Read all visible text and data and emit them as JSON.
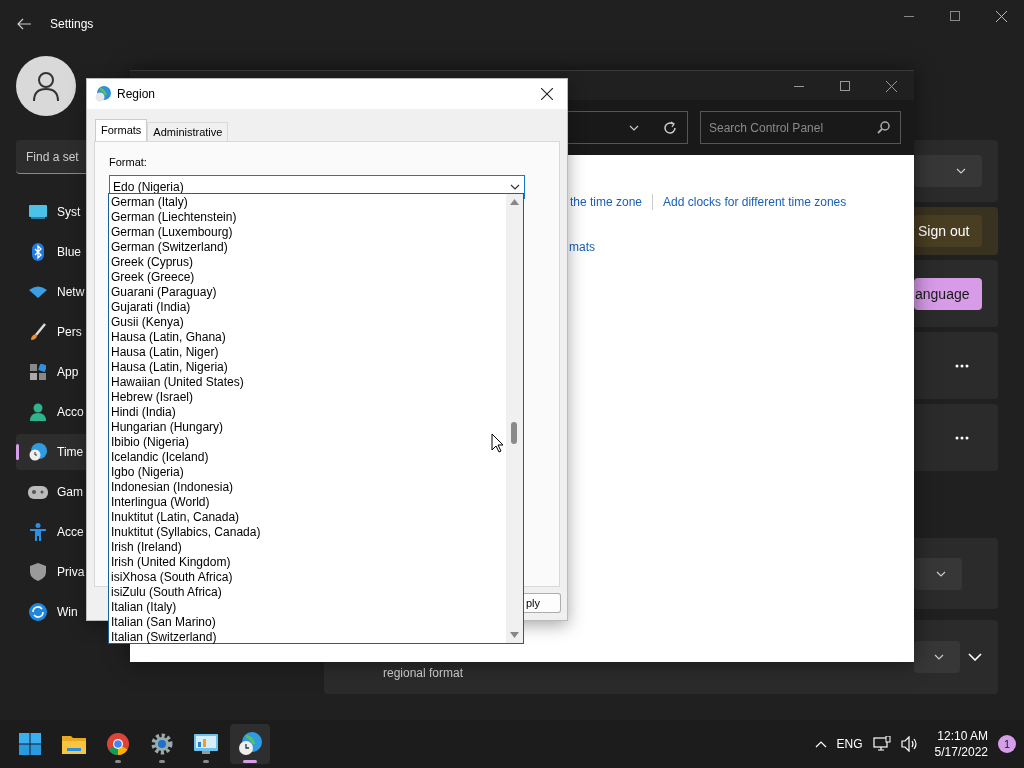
{
  "settings": {
    "title": "Settings",
    "search": {
      "placeholder": "Find a set"
    },
    "sidebar": {
      "items": [
        {
          "label": "Syst",
          "kind": "system",
          "selected": false
        },
        {
          "label": "Blue",
          "kind": "bluetooth",
          "selected": false
        },
        {
          "label": "Netw",
          "kind": "network",
          "selected": false
        },
        {
          "label": "Pers",
          "kind": "brush",
          "selected": false
        },
        {
          "label": "App",
          "kind": "apps",
          "selected": false
        },
        {
          "label": "Acco",
          "kind": "accounts",
          "selected": false
        },
        {
          "label": "Time",
          "kind": "time",
          "selected": true
        },
        {
          "label": "Gam",
          "kind": "gaming",
          "selected": false
        },
        {
          "label": "Acce",
          "kind": "accessibility",
          "selected": false
        },
        {
          "label": "Priva",
          "kind": "privacy",
          "selected": false
        },
        {
          "label": "Win",
          "kind": "update",
          "selected": false
        }
      ]
    },
    "cards": [
      {
        "kind": "dropdown"
      },
      {
        "kind": "warning_button",
        "label": "Sign out"
      },
      {
        "kind": "accent_button",
        "label": "anguage"
      },
      {
        "kind": "more"
      },
      {
        "kind": "more"
      },
      {
        "kind": "dropdown"
      },
      {
        "kind": "dropdown_expand",
        "description": "regional format"
      }
    ]
  },
  "control_panel": {
    "search": {
      "placeholder": "Search Control Panel"
    },
    "links": [
      {
        "label": "the time zone"
      },
      {
        "label": "Add clocks for different time zones"
      }
    ],
    "second_link": "mats"
  },
  "region_dialog": {
    "title": "Region",
    "tabs": [
      {
        "label": "Formats",
        "selected": true
      },
      {
        "label": "Administrative",
        "selected": false
      }
    ],
    "format_label": "Format:",
    "format_value": "Edo (Nigeria)",
    "apply_button": "ply",
    "format_list": [
      "German (Italy)",
      "German (Liechtenstein)",
      "German (Luxembourg)",
      "German (Switzerland)",
      "Greek (Cyprus)",
      "Greek (Greece)",
      "Guarani (Paraguay)",
      "Gujarati (India)",
      "Gusii (Kenya)",
      "Hausa (Latin, Ghana)",
      "Hausa (Latin, Niger)",
      "Hausa (Latin, Nigeria)",
      "Hawaiian (United States)",
      "Hebrew (Israel)",
      "Hindi (India)",
      "Hungarian (Hungary)",
      "Ibibio (Nigeria)",
      "Icelandic (Iceland)",
      "Igbo (Nigeria)",
      "Indonesian (Indonesia)",
      "Interlingua (World)",
      "Inuktitut (Latin, Canada)",
      "Inuktitut (Syllabics, Canada)",
      "Irish (Ireland)",
      "Irish (United Kingdom)",
      "isiXhosa (South Africa)",
      "isiZulu (South Africa)",
      "Italian (Italy)",
      "Italian (San Marino)",
      "Italian (Switzerland)"
    ]
  },
  "taskbar": {
    "apps": [
      {
        "kind": "start",
        "running": false,
        "active": false
      },
      {
        "kind": "folder",
        "running": false,
        "active": false
      },
      {
        "kind": "browser",
        "running": true,
        "active": false
      },
      {
        "kind": "gear",
        "running": true,
        "active": false
      },
      {
        "kind": "control_panel",
        "running": true,
        "active": false
      },
      {
        "kind": "globe_clock",
        "running": true,
        "active": true
      }
    ],
    "language": "ENG",
    "time": "12:10 AM",
    "date": "5/17/2022",
    "notification_count": "1"
  }
}
